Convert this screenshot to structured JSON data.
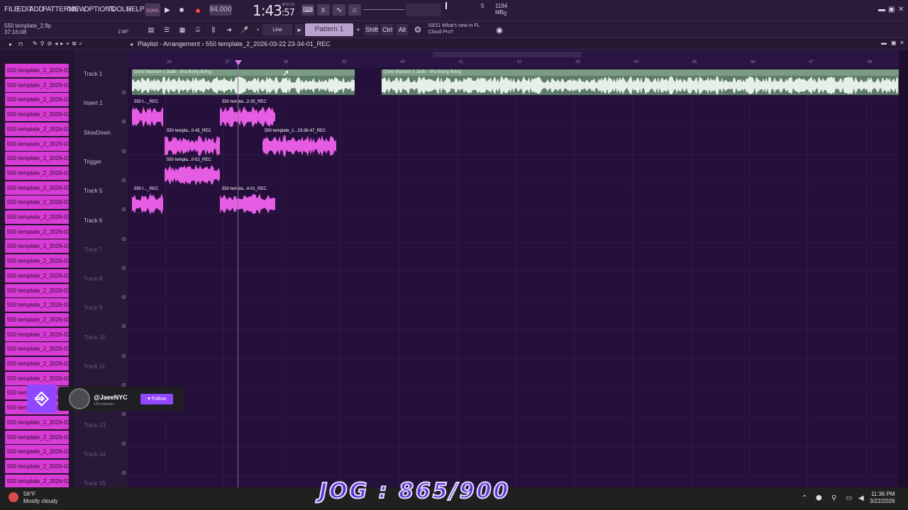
{
  "menu": [
    "FILE",
    "EDIT",
    "ADD",
    "PATTERNS",
    "VIEW",
    "OPTIONS",
    "TOOLS",
    "HELP"
  ],
  "transport": {
    "song_mode": "SONG",
    "tempo": "84.000",
    "time_main": "1:43",
    "time_sub": ":57",
    "time_label": "M:S:CS"
  },
  "cpu": {
    "voices": "5",
    "memory": "1194 MB",
    "count": "0"
  },
  "toolbar2": {
    "file_name": "550 template_2.flp",
    "file_time": "37:16:08",
    "hint_value": "1'46\"",
    "snap_label": "Line",
    "pattern_label": "Pattern 1",
    "shift_label": "Shift",
    "ctrl_label": "Ctrl",
    "alt_label": "Alt",
    "news_date": "03/11",
    "news_text_1": "What's new in FL",
    "news_text_2": "Cloud Pro?"
  },
  "playlist": {
    "title_1": "Playlist - Arrangement",
    "title_2": "550 template_2_2026-03-22 23-34-01_REC"
  },
  "ruler": [
    "36",
    "37",
    "38",
    "39",
    "40",
    "41",
    "42",
    "43",
    "44",
    "45",
    "46",
    "47",
    "48"
  ],
  "picker_items": [
    "550 template_2_2026-03...",
    "550 template_2_2026-03...",
    "550 template_2_2026-03...",
    "550 template_2_2026-03...",
    "550 template_2_2026-03...",
    "550 template_2_2026-03...",
    "550 template_2_2026-03...",
    "550 template_2_2026-03...",
    "550 template_2_2026-03...",
    "550 template_2_2026-03...",
    "550 template_2_2026-03...",
    "550 template_2_2026-03...",
    "550 template_2_2026-03...",
    "550 template_2_2026-03...",
    "550 template_2_2026-03...",
    "550 template_2_2026-03...",
    "550 template_2_2026-03...",
    "550 template_2_2026-03...",
    "550 template_2_2026-03...",
    "550 template_2_2026-03...",
    "550 template_2_2026-03...",
    "550 template_2_2026-03...",
    "550 template_2_2026-03...",
    "550 template_2_2026-03...",
    "550 template_2_2026-03...",
    "550 template_2_2026-03...",
    "550 template_2_2026-03...",
    "550 template_2_2026-03...",
    "550 template_2_2026-03...",
    "550 template_2_2026-03..."
  ],
  "tracks": [
    "Track 1",
    "Insert 1",
    "SlowDown",
    "Trigger",
    "Track 5",
    "Track 6",
    "Track 7",
    "Track 8",
    "Track 9",
    "Track 10",
    "Track 11",
    "Track 12",
    "Track 13",
    "Track 14",
    "Track 15"
  ],
  "clips": {
    "audio_1": "Chris Wackem x JaeB - Sha Boing Boing",
    "audio_2": "Chris Wackem x JaeB - Sha Boing Boing",
    "c1": "550 t..._REC",
    "c2": "550 templa...2-35_REC",
    "c3": "550 templa...0-45_REC",
    "c4": "550 template_2...23-36-47_REC",
    "c5": "550 templa...0-52_REC",
    "c6": "550 t..._REC",
    "c7": "550 templa...4-01_REC"
  },
  "twitch": {
    "name": "@JaeeNYC",
    "sub": "199 followers",
    "follow": "Follow"
  },
  "overlay": {
    "jog": "JOG : 865/900"
  },
  "taskbar": {
    "temp": "56°F",
    "weather": "Mostly cloudy",
    "time": "11:36 PM",
    "date": "3/22/2026"
  },
  "colors": {
    "accent": "#d93cd6",
    "bg": "#24103a",
    "twitch": "#9146ff"
  }
}
